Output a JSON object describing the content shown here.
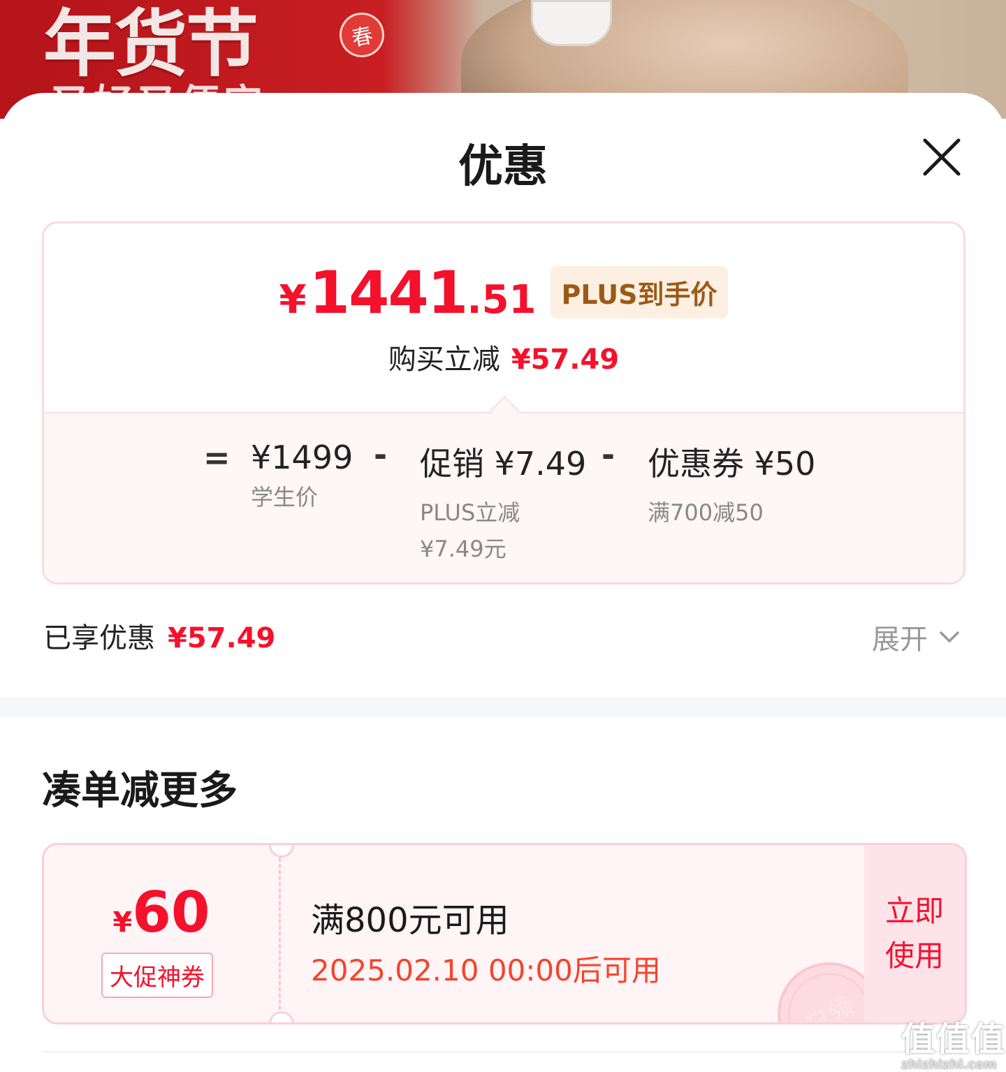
{
  "banner": {
    "title": "年货节",
    "subtitle": "又好又便宜",
    "badge": "春"
  },
  "sheet": {
    "title": "优惠"
  },
  "price_card": {
    "currency": "¥",
    "price_int": "1441",
    "price_dec": ".51",
    "price_tag": "PLUS到手价",
    "saving_label": "购买立减",
    "saving_amount": "¥57.49",
    "breakdown": {
      "equals": "=",
      "minus": "-",
      "base_amount": "¥1499",
      "base_label": "学生价",
      "promo_title": "促销 ¥7.49",
      "promo_sub1": "PLUS立减",
      "promo_sub2": "¥7.49元",
      "coupon_title": "优惠券 ¥50",
      "coupon_sub": "满700减50"
    }
  },
  "enjoyed": {
    "label": "已享优惠",
    "amount": "¥57.49",
    "expand_label": "展开"
  },
  "section": {
    "title": "凑单减更多"
  },
  "coupon": {
    "currency": "¥",
    "amount": "60",
    "tag": "大促神券",
    "condition": "满800元可用",
    "valid_time": "2025.02.10 00:00后可用",
    "action_line1": "立即",
    "action_line2": "使用",
    "stamp": "已领"
  },
  "watermark": {
    "main": "值值值",
    "url": "zhizhizhi.com"
  },
  "colors": {
    "accent_red": "#f5112b",
    "plus_tag_bg": "#fdf0e2",
    "plus_tag_text": "#9b5a18",
    "card_border": "#fbd9df"
  }
}
